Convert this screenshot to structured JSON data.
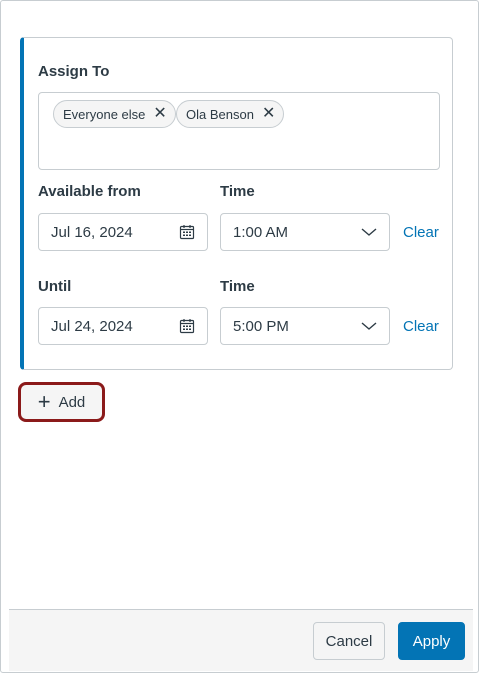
{
  "assign": {
    "label": "Assign To",
    "tags": [
      {
        "text": "Everyone else",
        "remove_icon": "close-icon"
      },
      {
        "text": "Ola Benson",
        "remove_icon": "close-icon"
      }
    ]
  },
  "available_from": {
    "date_label": "Available from",
    "date_value": "Jul 16, 2024",
    "time_label": "Time",
    "time_value": "1:00 AM",
    "clear_label": "Clear"
  },
  "until": {
    "date_label": "Until",
    "date_value": "Jul 24, 2024",
    "time_label": "Time",
    "time_value": "5:00 PM",
    "clear_label": "Clear"
  },
  "add_button": {
    "label": "Add",
    "icon": "plus-icon"
  },
  "footer": {
    "cancel_label": "Cancel",
    "apply_label": "Apply"
  },
  "colors": {
    "accent": "#0374b5",
    "highlight": "#8b1a1a",
    "text": "#2d3b45",
    "border": "#c7cdd1"
  }
}
